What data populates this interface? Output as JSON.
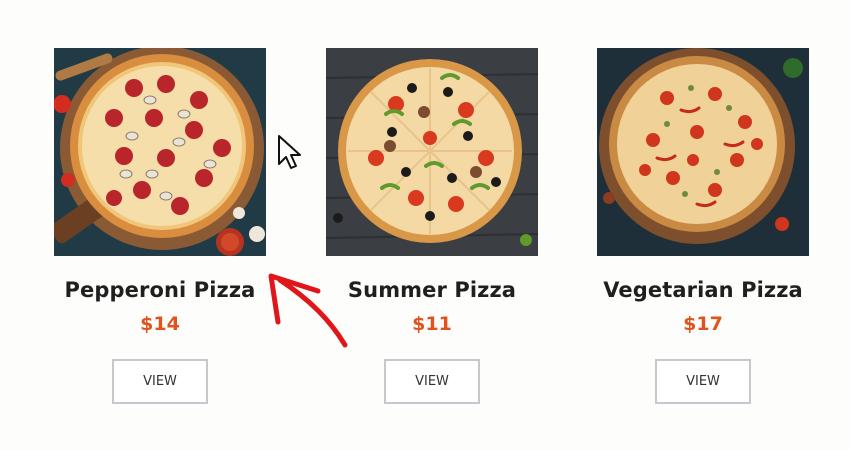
{
  "products": [
    {
      "name": "Pepperoni Pizza",
      "price": "$14",
      "button_label": "VIEW",
      "image_icon": "pepperoni-pizza-photo"
    },
    {
      "name": "Summer Pizza",
      "price": "$11",
      "button_label": "VIEW",
      "image_icon": "summer-pizza-photo"
    },
    {
      "name": "Vegetarian Pizza",
      "price": "$17",
      "button_label": "VIEW",
      "image_icon": "vegetarian-pizza-photo"
    }
  ],
  "colors": {
    "price": "#e0531e",
    "title": "#1f1f1f",
    "button_border": "#c8c8cc",
    "annotation_red": "#e0161b"
  },
  "overlay": {
    "cursor_icon": "arrow-cursor-icon",
    "annotation": "red-arrow-annotation-icon"
  }
}
